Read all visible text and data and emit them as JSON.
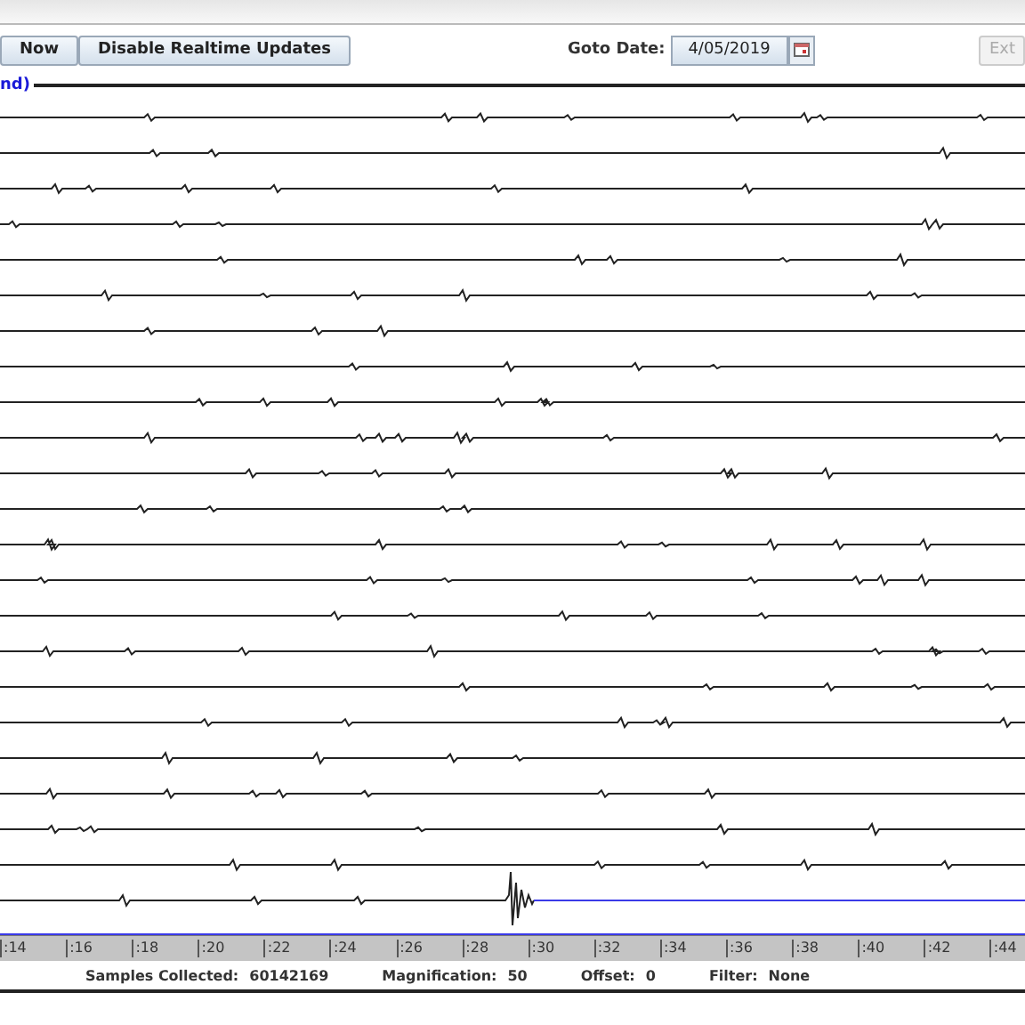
{
  "toolbar": {
    "buttons": [
      {
        "label": "Now"
      },
      {
        "label": "Disable Realtime Updates"
      }
    ],
    "goto_label": "Goto Date:",
    "date_value": "4/05/2019",
    "extra_button": {
      "label": "Ext",
      "disabled": true
    }
  },
  "channel_label": "nd)",
  "time_axis": {
    "ticks": [
      ":14",
      ":16",
      ":18",
      ":20",
      ":22",
      ":24",
      ":26",
      ":28",
      ":30",
      ":32",
      ":34",
      ":36",
      ":38",
      ":40",
      ":42",
      ":44"
    ]
  },
  "status_bar": [
    {
      "label": "Samples Collected:",
      "value": "60142169"
    },
    {
      "label": "Magnification:",
      "value": "50"
    },
    {
      "label": "Offset:",
      "value": "0"
    },
    {
      "label": "Filter:",
      "value": "None"
    }
  ]
}
